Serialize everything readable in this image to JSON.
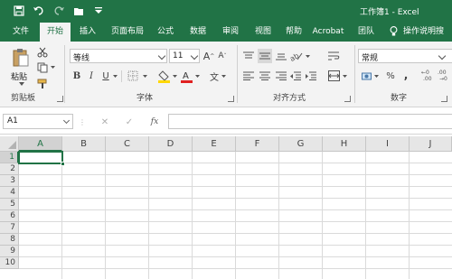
{
  "title_bar": {
    "title": "工作簿1 - Excel",
    "quick_access": [
      "save-icon",
      "undo-icon",
      "redo-icon",
      "open-icon",
      "customize-icon"
    ]
  },
  "menu": {
    "tabs": [
      {
        "label": "文件",
        "active": false
      },
      {
        "label": "开始",
        "active": true
      },
      {
        "label": "插入",
        "active": false
      },
      {
        "label": "页面布局",
        "active": false
      },
      {
        "label": "公式",
        "active": false
      },
      {
        "label": "数据",
        "active": false
      },
      {
        "label": "审阅",
        "active": false
      },
      {
        "label": "视图",
        "active": false
      },
      {
        "label": "帮助",
        "active": false
      },
      {
        "label": "Acrobat",
        "active": false
      },
      {
        "label": "团队",
        "active": false
      }
    ],
    "tell_me": "操作说明搜"
  },
  "ribbon": {
    "clipboard": {
      "paste_label": "粘贴",
      "group_label": "剪贴板"
    },
    "font": {
      "font_name": "等线",
      "font_size": "11",
      "grow": "A",
      "shrink": "A",
      "bold": "B",
      "italic": "I",
      "underline": "U",
      "phonetic": "文",
      "group_label": "字体",
      "accent_color": "#ffd700",
      "font_color": "#e02020"
    },
    "alignment": {
      "group_label": "对齐方式"
    },
    "number": {
      "format": "常规",
      "percent": "%",
      "comma": ",",
      "group_label": "数字"
    }
  },
  "formula_bar": {
    "name_box": "A1",
    "cancel": "✕",
    "enter": "✓",
    "fx": "fx",
    "formula": ""
  },
  "sheet": {
    "columns": [
      "A",
      "B",
      "C",
      "D",
      "E",
      "F",
      "G",
      "H",
      "I",
      "J"
    ],
    "rows": [
      "1",
      "2",
      "3",
      "4",
      "5",
      "6",
      "7",
      "8",
      "9",
      "10"
    ],
    "active_cell": "A1"
  },
  "colors": {
    "brand": "#217346",
    "ribbon_bg": "#f3f3f3",
    "header_bg": "#e6e6e6"
  }
}
